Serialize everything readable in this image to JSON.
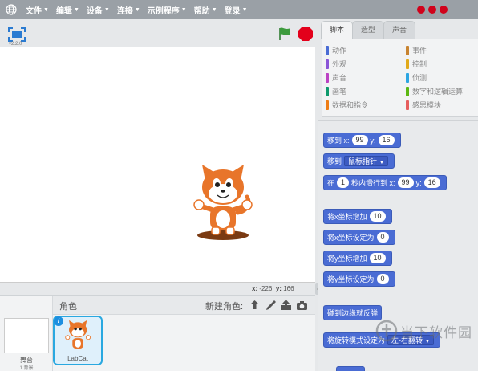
{
  "menubar": {
    "items": [
      {
        "label": "文件"
      },
      {
        "label": "编辑"
      },
      {
        "label": "设备"
      },
      {
        "label": "连接"
      },
      {
        "label": "示例程序"
      },
      {
        "label": "帮助"
      },
      {
        "label": "登录"
      }
    ],
    "window_dot_color": "#d0021b"
  },
  "stage": {
    "version": "v2.2.0",
    "coords": {
      "x_label": "x:",
      "x_value": "-226",
      "y_label": "y:",
      "y_value": "166"
    }
  },
  "sprites": {
    "title": "角色",
    "new_sprite_label": "新建角色:",
    "stage_label": "舞台",
    "backdrop_count": "1 背景",
    "items": [
      {
        "name": "LabCat",
        "selected": true
      }
    ]
  },
  "tabs": [
    {
      "label": "脚本",
      "active": true
    },
    {
      "label": "造型",
      "active": false
    },
    {
      "label": "声音",
      "active": false
    }
  ],
  "categories": [
    {
      "label": "动作",
      "color": "#4a6cd4"
    },
    {
      "label": "事件",
      "color": "#c88330"
    },
    {
      "label": "外观",
      "color": "#8a55d7"
    },
    {
      "label": "控制",
      "color": "#e1a91a"
    },
    {
      "label": "声音",
      "color": "#bb42c3"
    },
    {
      "label": "侦测",
      "color": "#2ca5e2"
    },
    {
      "label": "画笔",
      "color": "#0e9a6c"
    },
    {
      "label": "数字和逻辑运算",
      "color": "#5cb712"
    },
    {
      "label": "数据和指令",
      "color": "#ee7d16"
    },
    {
      "label": "感思模块",
      "color": "#e65d5d"
    }
  ],
  "blocks": {
    "goto_xy": {
      "prefix": "移到 x:",
      "x": "99",
      "y_label": "y:",
      "y": "16"
    },
    "goto_target": {
      "prefix": "移到",
      "target": "鼠标指针"
    },
    "glide": {
      "prefix": "在",
      "secs": "1",
      "mid": "秒内滑行到 x:",
      "x": "99",
      "y_label": "y:",
      "y": "16"
    },
    "change_x": {
      "label": "将x坐标增加",
      "value": "10"
    },
    "set_x": {
      "label": "将x坐标设定为",
      "value": "0"
    },
    "change_y": {
      "label": "将y坐标增加",
      "value": "10"
    },
    "set_y": {
      "label": "将y坐标设定为",
      "value": "0"
    },
    "bounce": {
      "label": "碰到边缘就反弹"
    },
    "rotation_style": {
      "label": "将旋转模式设定为",
      "value": "左-右翻转"
    }
  },
  "watermark": {
    "text": "当下软件园"
  }
}
